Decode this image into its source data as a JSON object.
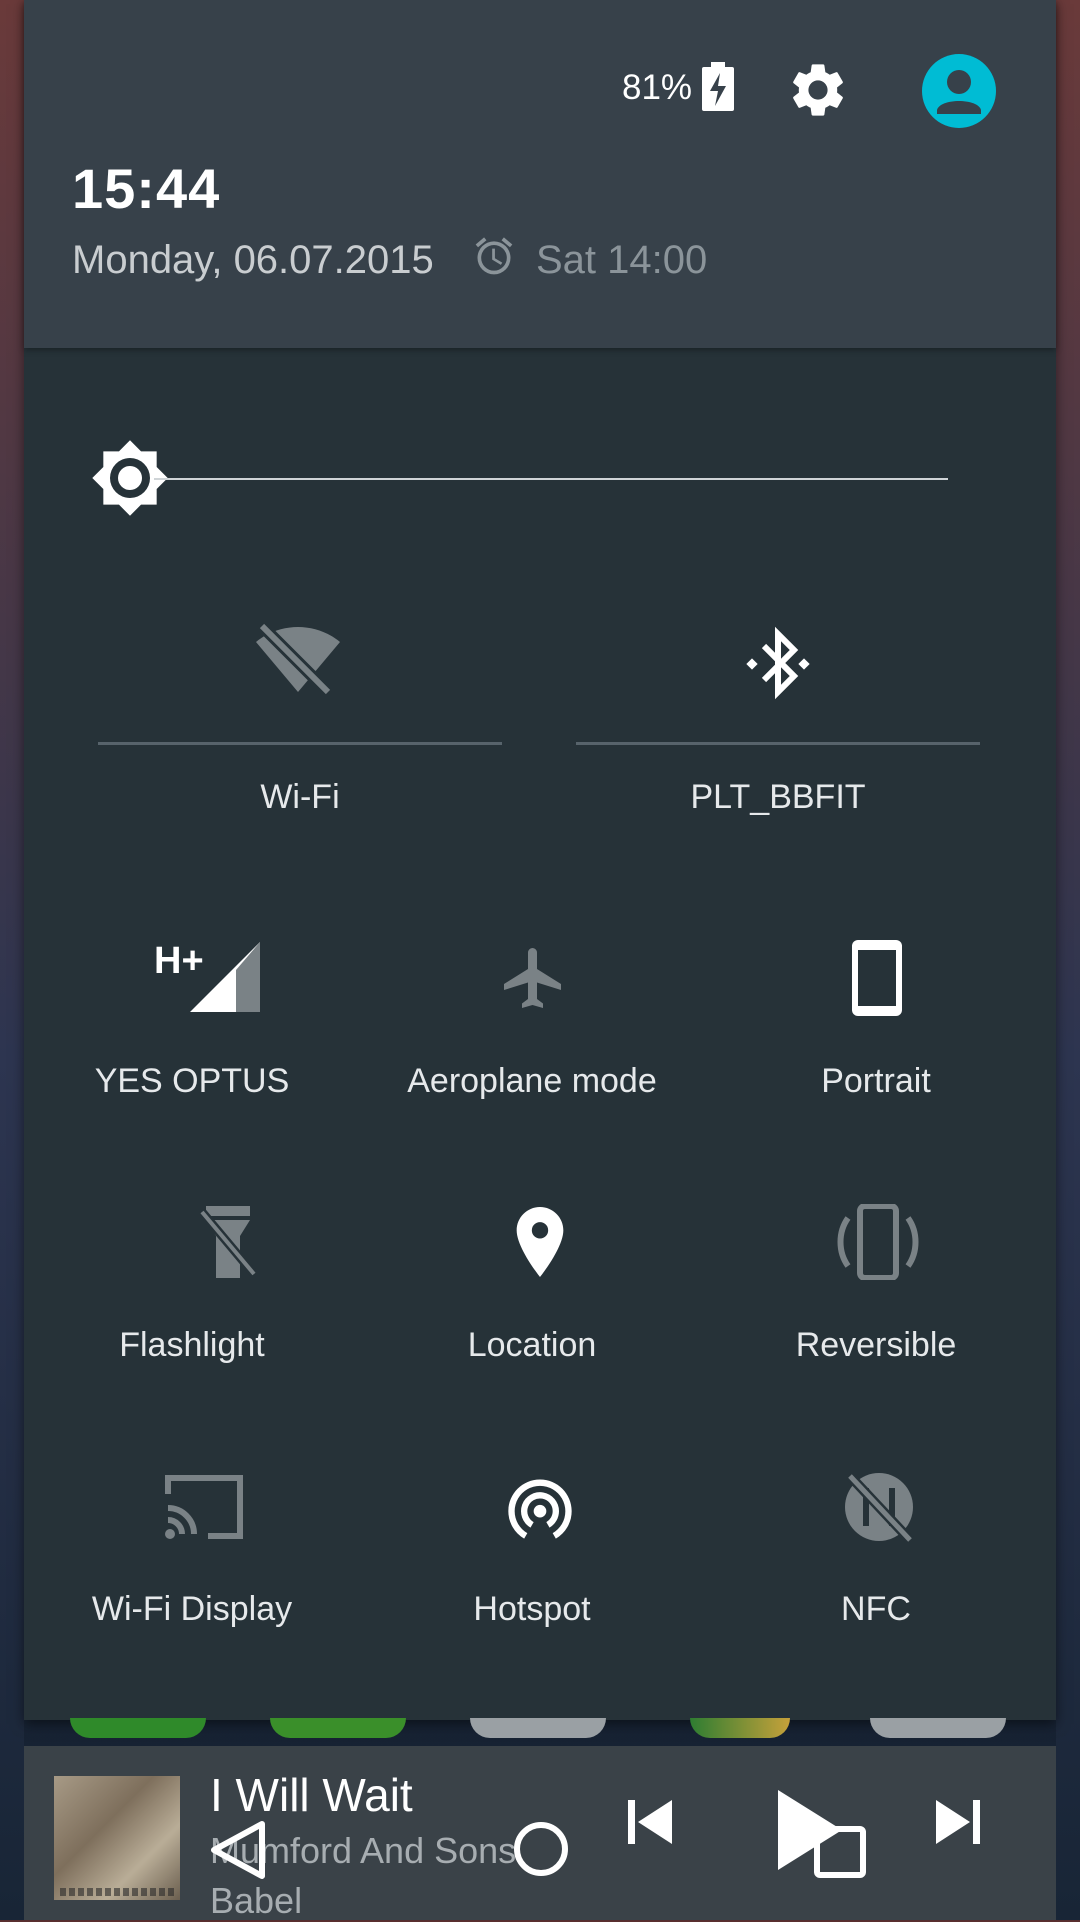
{
  "status": {
    "battery": "81%",
    "time": "15:44",
    "date": "Monday, 06.07.2015",
    "alarm": "Sat 14:00"
  },
  "brightness": {
    "level": 0.0
  },
  "tiles": {
    "wifi": "Wi-Fi",
    "bluetooth": "PLT_BBFIT",
    "mobile": "YES OPTUS",
    "aeroplane": "Aeroplane mode",
    "rotation": "Portrait",
    "flashlight": "Flashlight",
    "location": "Location",
    "reversible": "Reversible",
    "wifi_display": "Wi-Fi Display",
    "hotspot": "Hotspot",
    "nfc": "NFC"
  },
  "mobile_network_type": "H+",
  "media": {
    "title": "I Will Wait",
    "artist": "Mumford And Sons",
    "album": "Babel"
  },
  "colors": {
    "accent": "#00BCD4",
    "panel": "#263238",
    "header": "#37414A",
    "inactive_icon": "#7A8286"
  }
}
